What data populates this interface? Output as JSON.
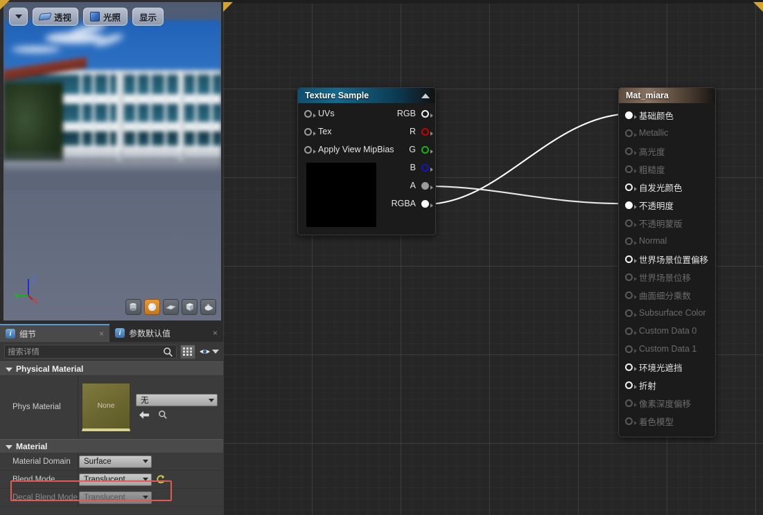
{
  "viewport": {
    "toolbar": {
      "dropdown_icon": "chevron-down-icon",
      "perspective_label": "透视",
      "lighting_label": "光照",
      "show_label": "显示"
    },
    "gizmo": {
      "z": "Z",
      "y": "Y",
      "x": "X"
    },
    "shapes": [
      {
        "name": "cylinder",
        "active": false
      },
      {
        "name": "sphere",
        "active": true
      },
      {
        "name": "plane",
        "active": false
      },
      {
        "name": "cube",
        "active": false
      },
      {
        "name": "teapot",
        "active": false
      }
    ]
  },
  "details": {
    "tabs": [
      {
        "label": "细节",
        "icon": "info-icon",
        "active": true,
        "close": "×"
      },
      {
        "label": "参数默认值",
        "icon": "info-icon",
        "active": false,
        "close": "×"
      }
    ],
    "search": {
      "placeholder": "搜索详情",
      "value": "",
      "icon": "search-icon"
    },
    "grid_button": "grid-view-icon",
    "eye_button": "visibility-icon",
    "categories": [
      {
        "title": "Physical Material",
        "rows": [
          {
            "label": "Phys Material",
            "thumbnail": "None",
            "combo": "无",
            "dim": false,
            "back_icon": "back-arrow-icon",
            "browse_icon": "search-icon"
          }
        ]
      },
      {
        "title": "Material",
        "rows": [
          {
            "label": "Material Domain",
            "combo": "Surface",
            "dim": false
          },
          {
            "label": "Blend Mode",
            "combo": "Translucent",
            "dim": false,
            "highlighted": true,
            "revert_icon": "revert-arrow-icon"
          },
          {
            "label": "Decal Blend Mode",
            "combo": "Translucent",
            "dim": true
          }
        ]
      }
    ],
    "highlight_color": "#e35a52"
  },
  "graph": {
    "nodes": [
      {
        "title": "Texture Sample",
        "header_color": "#15698e",
        "collapse_icon": "chevron-up-icon",
        "inputs": [
          {
            "label": "UVs",
            "connected": false
          },
          {
            "label": "Tex",
            "connected": false
          },
          {
            "label": "Apply View MipBias",
            "connected": false
          }
        ],
        "outputs": [
          {
            "label": "RGB",
            "color": "#ffffff",
            "connected": false
          },
          {
            "label": "R",
            "color": "#c80000",
            "connected": false
          },
          {
            "label": "G",
            "color": "#16b516",
            "connected": false
          },
          {
            "label": "B",
            "color": "#1414c8",
            "connected": false
          },
          {
            "label": "A",
            "color": "#9a9a9a",
            "connected": true
          },
          {
            "label": "RGBA",
            "color": "#ffffff",
            "connected": true
          }
        ],
        "preview_color": "#000000"
      },
      {
        "title": "Mat_miara",
        "header_color": "#8a7361",
        "inputs": [
          {
            "label": "基础颜色",
            "enabled": true,
            "connected": true
          },
          {
            "label": "Metallic",
            "enabled": false,
            "connected": false
          },
          {
            "label": "高光度",
            "enabled": false,
            "connected": false
          },
          {
            "label": "粗糙度",
            "enabled": false,
            "connected": false
          },
          {
            "label": "自发光颜色",
            "enabled": true,
            "connected": false
          },
          {
            "label": "不透明度",
            "enabled": true,
            "connected": true
          },
          {
            "label": "不透明蒙版",
            "enabled": false,
            "connected": false
          },
          {
            "label": "Normal",
            "enabled": false,
            "connected": false
          },
          {
            "label": "世界场景位置偏移",
            "enabled": true,
            "connected": false
          },
          {
            "label": "世界场景位移",
            "enabled": false,
            "connected": false
          },
          {
            "label": "曲面细分乘数",
            "enabled": false,
            "connected": false
          },
          {
            "label": "Subsurface Color",
            "enabled": false,
            "connected": false
          },
          {
            "label": "Custom Data 0",
            "enabled": false,
            "connected": false
          },
          {
            "label": "Custom Data 1",
            "enabled": false,
            "connected": false
          },
          {
            "label": "环境光遮挡",
            "enabled": true,
            "connected": false
          },
          {
            "label": "折射",
            "enabled": true,
            "connected": false
          },
          {
            "label": "像素深度偏移",
            "enabled": false,
            "connected": false
          },
          {
            "label": "着色模型",
            "enabled": false,
            "connected": false
          }
        ]
      }
    ],
    "wires": [
      {
        "from": "RGBA",
        "to": "基础颜色",
        "color": "#ffffff"
      },
      {
        "from": "A",
        "to": "不透明度",
        "color": "#e0e0e0"
      }
    ]
  }
}
